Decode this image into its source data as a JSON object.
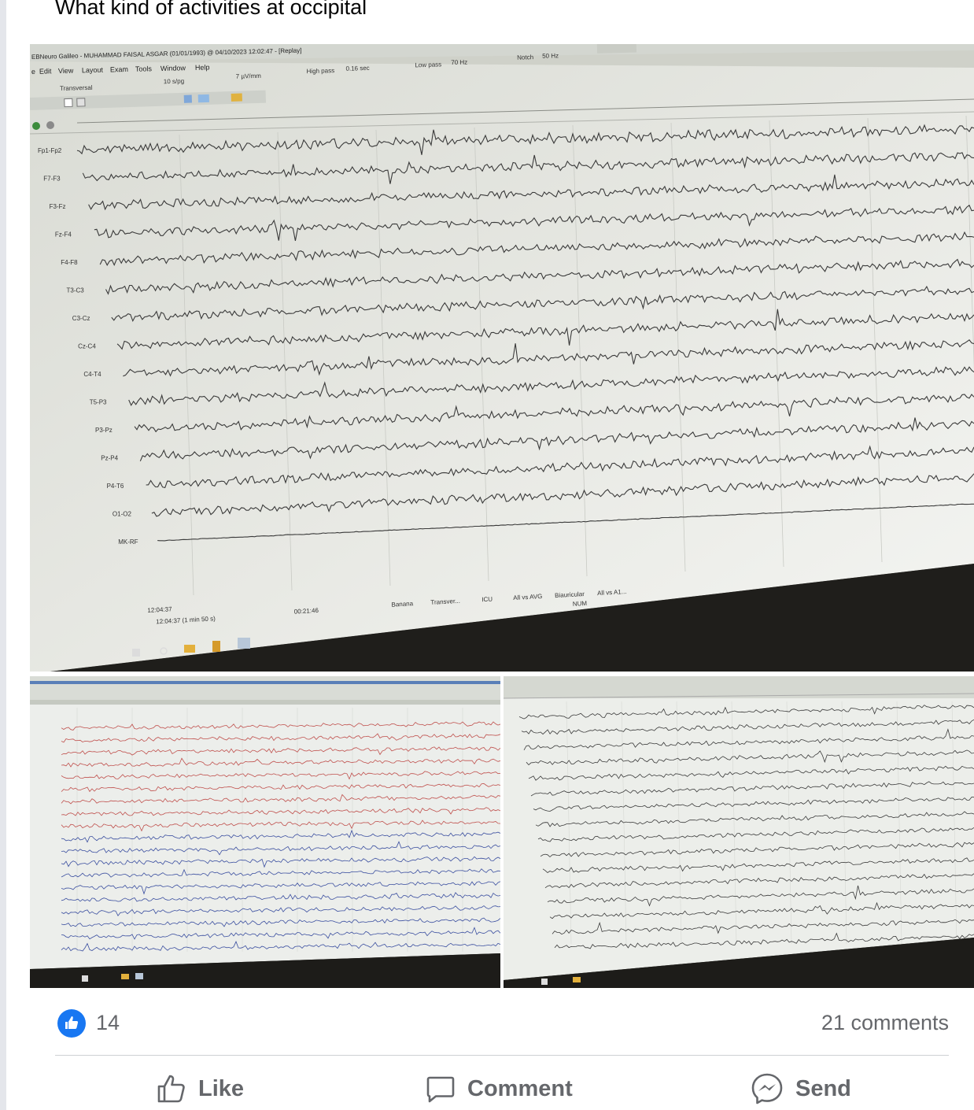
{
  "post": {
    "text": "What kind of activities at occipital"
  },
  "eeg_screen": {
    "title": "EBNeuro Galileo - MUHAMMAD FAISAL ASGAR (01/01/1993) @ 04/10/2023 12:02:47 - [Replay]",
    "menu": [
      "e",
      "Edit",
      "View",
      "Layout",
      "Exam",
      "Tools",
      "Window",
      "Help"
    ],
    "montage": "Transversal",
    "speed": "10 s/pg",
    "sensitivity": "7 µV/mm",
    "high_pass_label": "High pass",
    "high_pass_value": "0.16 sec",
    "low_pass_label": "Low pass",
    "low_pass_value": "70 Hz",
    "notch_label": "Notch",
    "notch_value": "50 Hz",
    "channels": [
      "Fp1-Fp2",
      "F7-F3",
      "F3-Fz",
      "Fz-F4",
      "F4-F8",
      "T3-C3",
      "C3-Cz",
      "Cz-C4",
      "C4-T4",
      "T5-P3",
      "P3-Pz",
      "Pz-P4",
      "P4-T6",
      "O1-O2",
      "MK-RF"
    ],
    "status": {
      "clock": "12:04:37",
      "position": "12:04:37 (1 min 50 s)",
      "elapsed": "00:21:46",
      "montage_tabs": [
        "Banana",
        "Transver...",
        "ICU",
        "All vs AVG",
        "Biauricular",
        "All vs A1..."
      ],
      "num": "NUM"
    }
  },
  "photos": [
    {
      "id": "main",
      "trace_color": "#3a3a3a"
    },
    {
      "id": "bottom-left",
      "trace_colors": [
        "#c0504d",
        "#3b4fa0"
      ]
    },
    {
      "id": "bottom-right",
      "trace_color": "#3a3a3a"
    }
  ],
  "reactions": {
    "like_count": "14",
    "comments": "21 comments"
  },
  "actions": {
    "like": "Like",
    "comment": "Comment",
    "send": "Send"
  },
  "colors": {
    "facebook_blue": "#1877f2",
    "secondary_text": "#65676b"
  }
}
